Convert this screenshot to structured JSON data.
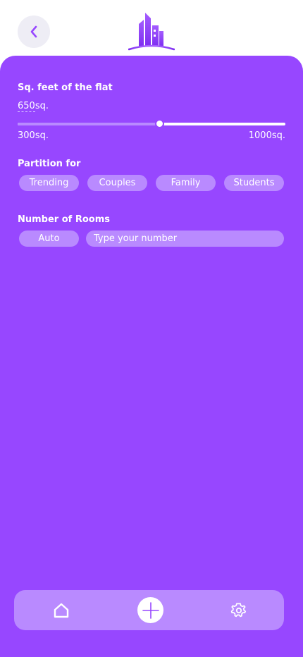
{
  "header": {
    "back_icon": "chevron-left-icon",
    "logo_icon": "city-buildings-logo"
  },
  "sqft": {
    "title": "Sq. feet of the flat",
    "value": "650",
    "unit": "sq.",
    "min_label": "300sq.",
    "max_label": "1000sq.",
    "slider_fraction": 0.53
  },
  "partition": {
    "title": "Partition for",
    "options": [
      "Trending",
      "Couples",
      "Family",
      "Students"
    ]
  },
  "rooms": {
    "title": "Number of Rooms",
    "auto_label": "Auto",
    "input_placeholder": "Type your number"
  },
  "bottom_nav": {
    "items": [
      "home-icon",
      "add-icon",
      "settings-icon"
    ]
  },
  "colors": {
    "primary": "#9747ff",
    "chip": "#b98aff",
    "back_button_bg": "#eeedf5"
  }
}
